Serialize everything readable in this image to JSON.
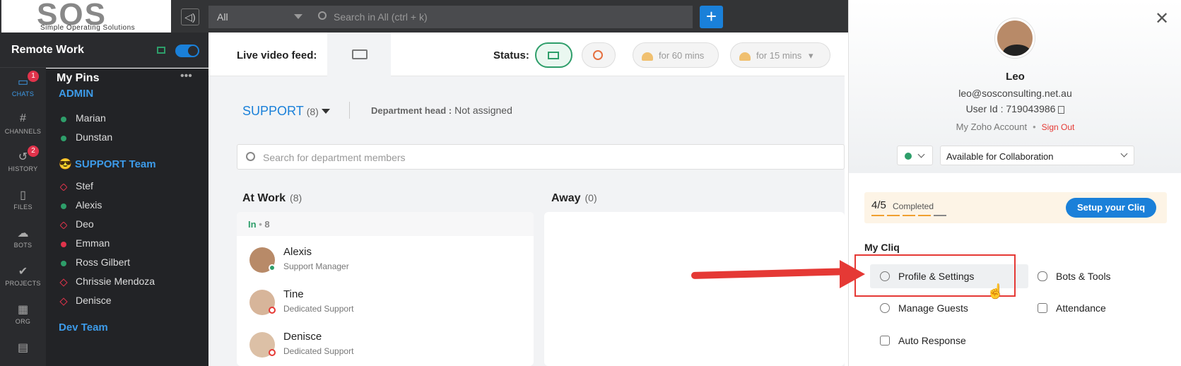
{
  "logo": {
    "name": "SOS",
    "tagline": "Simple Operating Solutions"
  },
  "search": {
    "scope": "All",
    "placeholder": "Search in All (ctrl + k)"
  },
  "rail": {
    "title": "Remote Work",
    "items": [
      {
        "label": "CHATS",
        "icon": "chat-icon",
        "badge": "1"
      },
      {
        "label": "CHANNELS",
        "icon": "hash-icon",
        "badge": ""
      },
      {
        "label": "HISTORY",
        "icon": "history-icon",
        "badge": "2"
      },
      {
        "label": "FILES",
        "icon": "file-icon",
        "badge": ""
      },
      {
        "label": "BOTS",
        "icon": "bot-icon",
        "badge": ""
      },
      {
        "label": "PROJECTS",
        "icon": "projects-icon",
        "badge": ""
      },
      {
        "label": "ORG",
        "icon": "org-icon",
        "badge": ""
      }
    ]
  },
  "pins": {
    "title": "My Pins",
    "groups": [
      {
        "name": "ADMIN"
      },
      {
        "name": "SUPPORT Team",
        "emoji": "😎"
      },
      {
        "name": "Dev Team"
      }
    ],
    "admin": [
      "Marian",
      "Dunstan"
    ],
    "support": [
      "Stef",
      "Alexis",
      "Deo",
      "Emman",
      "Ross Gilbert",
      "Chrissie Mendoza",
      "Denisce"
    ]
  },
  "status_bar": {
    "live_label": "Live video feed:",
    "status_label": "Status:",
    "chip_60": "for 60 mins",
    "chip_15": "for 15 mins"
  },
  "department": {
    "name": "SUPPORT",
    "count": "(8)",
    "head_label": "Department head :",
    "head_value": "Not assigned",
    "search_placeholder": "Search for department members"
  },
  "columns": {
    "at_work": {
      "title": "At Work",
      "count": "(8)"
    },
    "away": {
      "title": "Away",
      "count": "(0)"
    },
    "in_label": "In",
    "in_count": "8"
  },
  "members": [
    {
      "name": "Alexis",
      "role": "Support Manager"
    },
    {
      "name": "Tine",
      "role": "Dedicated Support"
    },
    {
      "name": "Denisce",
      "role": "Dedicated Support"
    }
  ],
  "profile": {
    "name": "Leo",
    "email": "leo@sosconsulting.net.au",
    "user_id": "User Id : 719043986",
    "account_link": "My Zoho Account",
    "sign_out": "Sign Out",
    "status_value": "Available for Collaboration",
    "progress_num": "4/5",
    "progress_label": "Completed",
    "progress_fraction": 0.8,
    "setup_label": "Setup your Cliq",
    "mycliq_title": "My Cliq",
    "items": {
      "profile_settings": "Profile & Settings",
      "bots_tools": "Bots & Tools",
      "manage_guests": "Manage Guests",
      "attendance": "Attendance",
      "auto_response": "Auto Response"
    }
  },
  "colors": {
    "accent": "#1a80d9",
    "online": "#2e9e6a",
    "alert": "#e53935",
    "brand_orange": "#f5a623"
  }
}
